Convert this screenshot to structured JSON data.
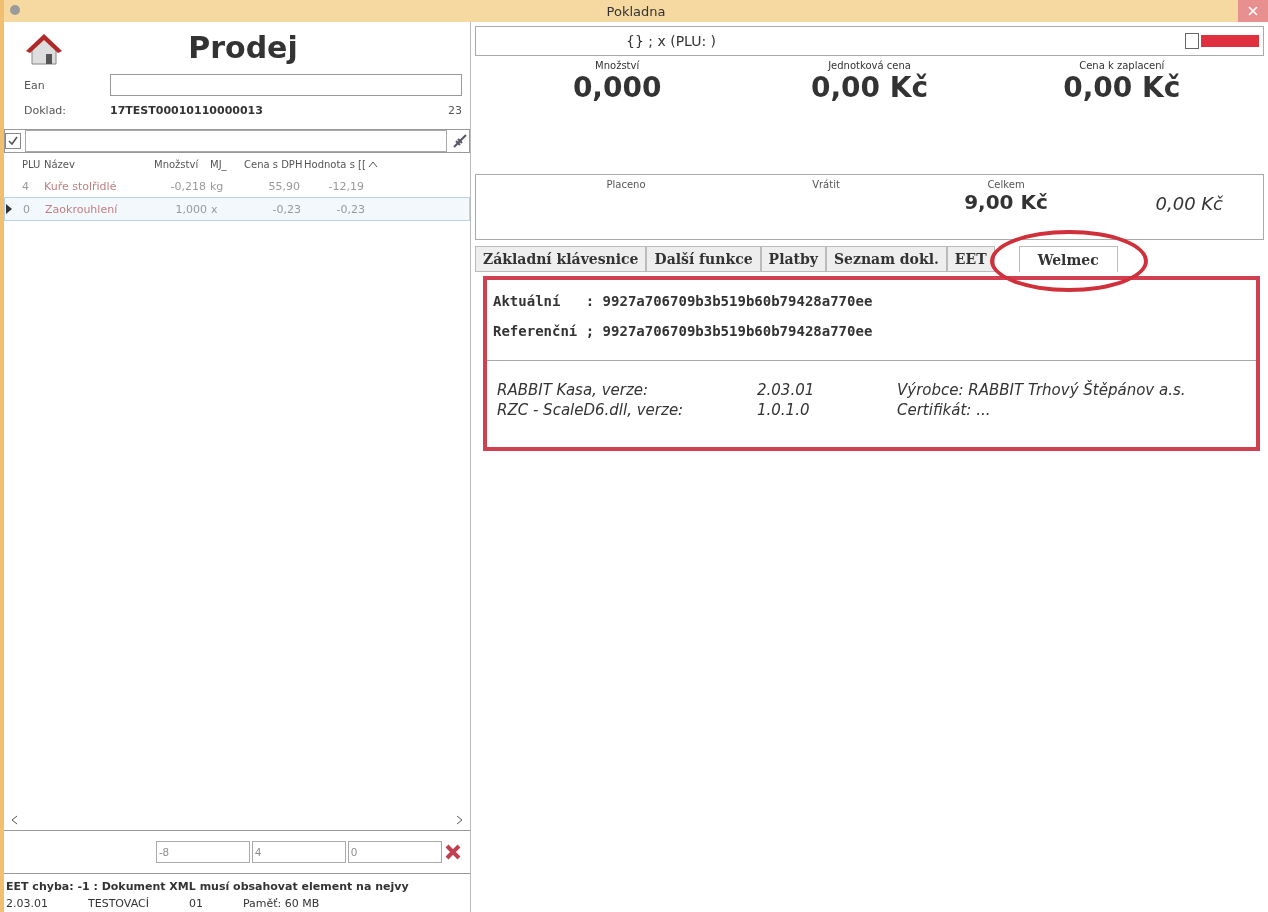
{
  "window": {
    "title": "Pokladna"
  },
  "sale": {
    "title": "Prodej",
    "ean_label": "Ean",
    "doklad_label": "Doklad:",
    "doklad_value": "17TEST00010110000013",
    "doklad_count": "23",
    "filter_checked": true
  },
  "table": {
    "columns": [
      "PLU",
      "Název",
      "Množství",
      "MJ_",
      "Cena s DPH",
      "Hodnota s [["
    ],
    "rows": [
      {
        "plu": "4",
        "name": "Kuře stolřidlé",
        "qty": "-0,218",
        "unit": "kg",
        "price": "55,90",
        "value": "-12,19",
        "selected": false
      },
      {
        "plu": "0",
        "name": "Zaokrouhlení",
        "qty": "1,000",
        "unit": "x",
        "price": "-0,23",
        "value": "-0,23",
        "selected": true
      }
    ]
  },
  "counters": [
    "-8",
    "4",
    "0"
  ],
  "error_message": "EET chyba: -1 : Dokument XML musí obsahovat element na nejvy",
  "status_bar": [
    "2.03.01",
    "TESTOVACÍ",
    "01",
    "Paměť: 60 MB"
  ],
  "display": {
    "text": "{} ; x (PLU: )",
    "checked": false
  },
  "amounts": [
    {
      "label": "Množství",
      "value": "0,000"
    },
    {
      "label": "Jednotková cena",
      "value": "0,00 Kč"
    },
    {
      "label": "Cena k zaplacení",
      "value": "0,00 Kč"
    }
  ],
  "payment": {
    "paid_label": "Placeno",
    "change_label": "Vrátit",
    "total_label": "Celkem",
    "total_value": "9,00 Kč",
    "remaining": "0,00 Kč"
  },
  "tabs": [
    {
      "label": "Základní klávesnice",
      "selected": false
    },
    {
      "label": "Další funkce",
      "selected": false
    },
    {
      "label": "Platby",
      "selected": false
    },
    {
      "label": "Seznam dokl.",
      "selected": false
    },
    {
      "label": "EET",
      "selected": false
    },
    {
      "label": "Welmec",
      "selected": true
    }
  ],
  "welmec": {
    "checksums": [
      {
        "label": "Aktuální",
        "sep": ":",
        "value": "9927a706709b3b519b60b79428a770ee"
      },
      {
        "label": "Referenční",
        "sep": ";",
        "value": "9927a706709b3b519b60b79428a770ee"
      }
    ],
    "info": [
      [
        "RABBIT Kasa, verze:",
        "2.03.01",
        "Výrobce: RABBIT Trhový Štěpánov a.s."
      ],
      [
        "RZC - ScaleD6.dll, verze:",
        "1.0.1.0",
        "Certifikát: ..."
      ]
    ]
  }
}
